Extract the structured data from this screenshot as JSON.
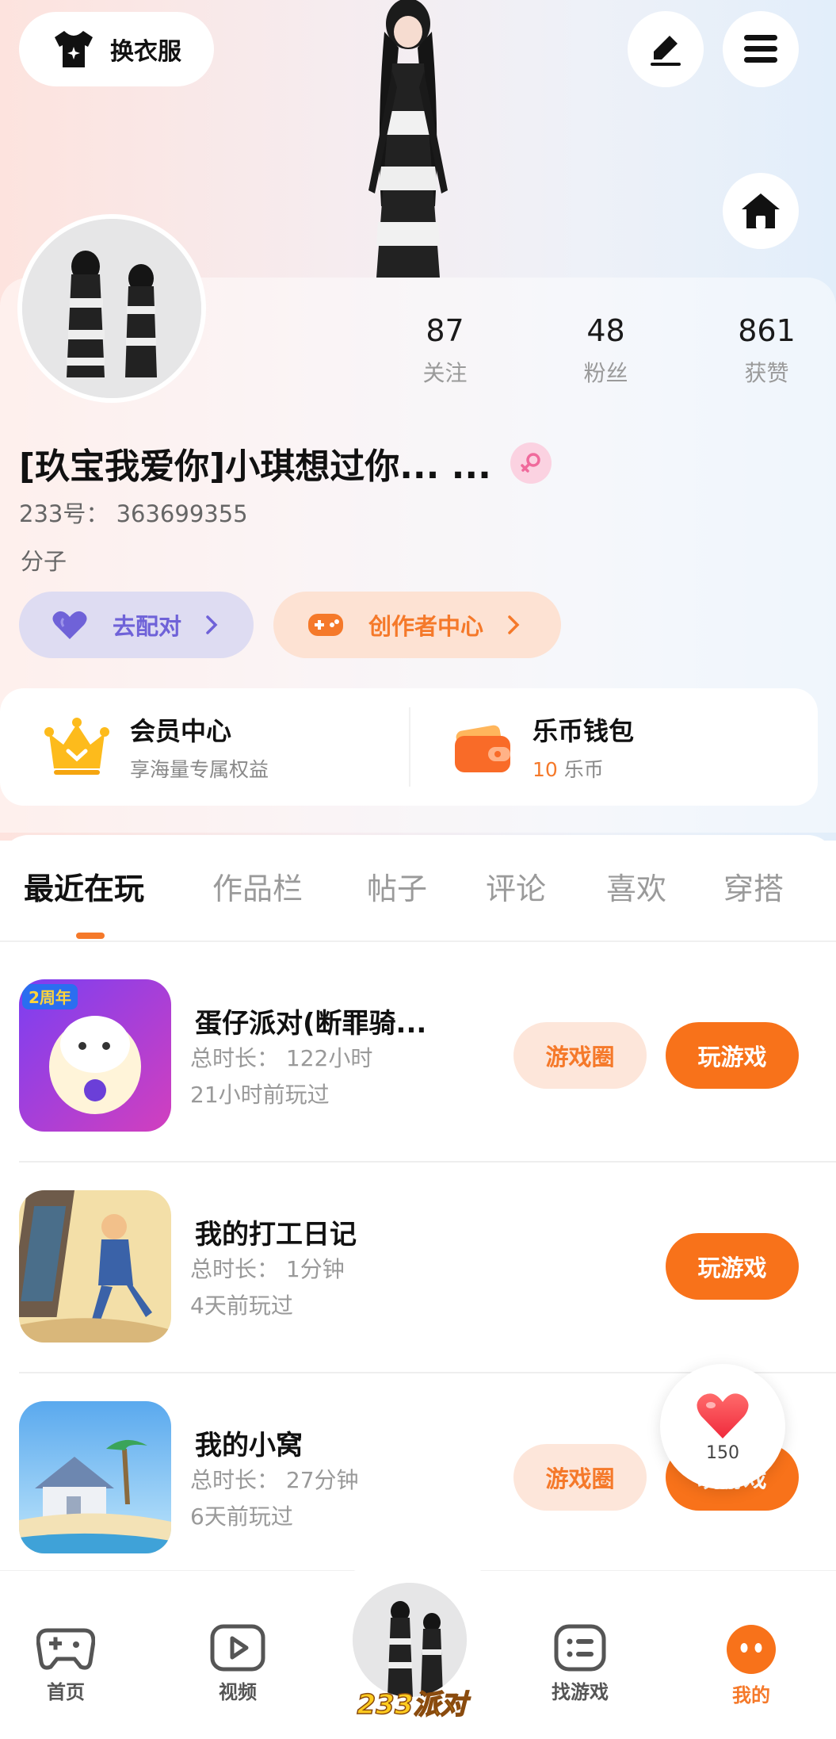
{
  "header": {
    "outfit_label": "换衣服"
  },
  "profile": {
    "stats": [
      {
        "value": "87",
        "label": "关注"
      },
      {
        "value": "48",
        "label": "粉丝"
      },
      {
        "value": "861",
        "label": "获赞"
      }
    ],
    "nickname": "[玖宝我爱你]小琪想过你... ...",
    "uid": "233号： 363699355",
    "bio": "分子",
    "match_button": "去配对",
    "creator_button": "创作者中心"
  },
  "cards": {
    "vip_title": "会员中心",
    "vip_subtitle": "享海量专属权益",
    "wallet_title": "乐币钱包",
    "wallet_amount": "10",
    "wallet_unit": "乐币"
  },
  "tabs": [
    "最近在玩",
    "作品栏",
    "帖子",
    "评论",
    "喜欢",
    "穿搭"
  ],
  "games": [
    {
      "title": "蛋仔派对(断罪骑...",
      "duration": "总时长： 122小时",
      "last_played": "21小时前玩过",
      "circle_label": "游戏圈",
      "play_label": "玩游戏"
    },
    {
      "title": "我的打工日记",
      "duration": "总时长： 1分钟",
      "last_played": "4天前玩过",
      "play_label": "玩游戏"
    },
    {
      "title": "我的小窝",
      "duration": "总时长： 27分钟",
      "last_played": "6天前玩过",
      "circle_label": "游戏圈",
      "play_label": "玩游戏"
    }
  ],
  "like_bubble": {
    "count": "150"
  },
  "bottom_nav": {
    "home": "首页",
    "video": "视频",
    "center": "233派对",
    "find": "找游戏",
    "me": "我的"
  },
  "colors": {
    "accent": "#f5792a",
    "match": "#6f62d8"
  }
}
